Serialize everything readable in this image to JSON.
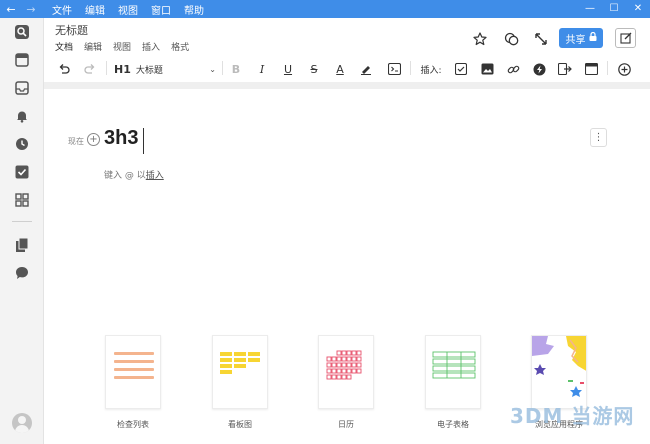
{
  "titlebar": {
    "back_icon": "arrow-left-icon",
    "forward_icon": "arrow-right-icon",
    "menu": [
      "文件",
      "编辑",
      "视图",
      "窗口",
      "帮助"
    ],
    "minimize": "—",
    "maximize": "☐",
    "close": "✕"
  },
  "sidebar": {
    "items": [
      {
        "name": "search-icon"
      },
      {
        "name": "calendar-icon"
      },
      {
        "name": "inbox-icon"
      },
      {
        "name": "bell-icon"
      },
      {
        "name": "clock-icon"
      },
      {
        "name": "checkbox-icon"
      },
      {
        "name": "grid-icon"
      },
      {
        "name": "documents-icon"
      },
      {
        "name": "chat-icon"
      }
    ]
  },
  "header": {
    "title": "无标题",
    "menu": [
      "文档",
      "编辑",
      "视图",
      "插入",
      "格式"
    ],
    "share_label": "共享"
  },
  "toolbar": {
    "heading_prefix": "H1",
    "heading_label": "大标题",
    "bold": "B",
    "italic": "I",
    "underline": "U",
    "strike": "S",
    "font_color": "A",
    "insert_label": "插入:"
  },
  "editor": {
    "now_label": "现在",
    "heading_text": "3h3",
    "hint_prefix": "键入 @ 以",
    "hint_link": "插入"
  },
  "templates": [
    {
      "label": "检查列表"
    },
    {
      "label": "看板图"
    },
    {
      "label": "日历"
    },
    {
      "label": "电子表格"
    },
    {
      "label": "浏览应用程序"
    }
  ],
  "watermark": "3DM 当游网",
  "colors": {
    "accent": "#3f8de8",
    "checklist": "#f4b48e",
    "kanban": "#f7d533",
    "calendar": "#e84f6a",
    "spreadsheet": "#5cc26a"
  }
}
